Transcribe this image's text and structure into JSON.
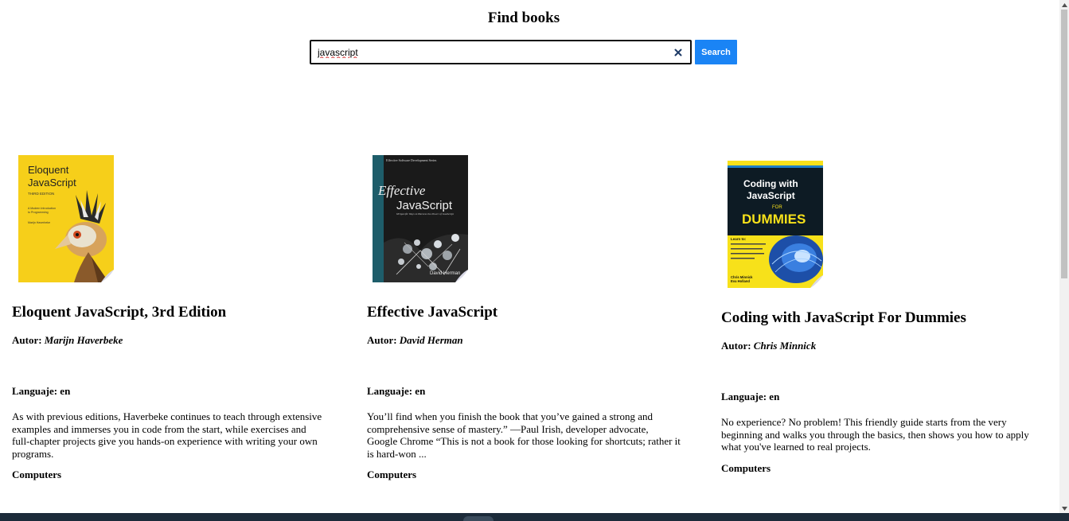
{
  "page": {
    "title": "Find books"
  },
  "search": {
    "value": "javascript",
    "placeholder": "",
    "button_label": "Search",
    "clear_icon": "close-icon"
  },
  "colors": {
    "search_button": "#1a84f5",
    "taskbar": "#1c2b3a"
  },
  "books": [
    {
      "title": "Eloquent JavaScript, 3rd Edition",
      "author_label": "Autor: ",
      "author": "Marijn Haverbeke",
      "language_label": "Languaje: en",
      "description": "As with previous editions, Haverbeke continues to teach through extensive examples and immerses you in code from the start, while exercises and full-chapter projects give you hands-on experience with writing your own programs.",
      "category": "Computers",
      "cover": {
        "title_line1": "Eloquent",
        "title_line2": "JavaScript",
        "edition": "THIRD EDITION",
        "subtitle_line1": "A Modern Introduction",
        "subtitle_line2": "to Programming",
        "author": "Marijn Haverbeke"
      }
    },
    {
      "title": "Effective JavaScript",
      "author_label": "Autor: ",
      "author": "David Herman",
      "language_label": "Languaje: en",
      "description": "You’ll find when you finish the book that you’ve gained a strong and comprehensive sense of mastery.” —Paul Irish, developer advocate, Google Chrome “This is not a book for those looking for shortcuts; rather it is hard-won ...",
      "category": "Computers",
      "cover": {
        "series": "Effective Software Development Series",
        "title_line1": "Effective",
        "title_line2": "JavaScript",
        "subtitle": "68 Specific Ways to Harness the Power of JavaScript",
        "author": "David Herman"
      }
    },
    {
      "title": "Coding with JavaScript For Dummies",
      "author_label": "Autor: ",
      "author": "Chris Minnick",
      "language_label": "Languaje: en",
      "description": "No experience? No problem! This friendly guide starts from the very beginning and walks you through the basics, then shows you how to apply what you've learned to real projects.",
      "category": "Computers",
      "cover": {
        "title_line1": "Coding with",
        "title_line2": "JavaScript",
        "for": "FOR",
        "dummies": "DUMMIES",
        "learn_to": "Learn to:",
        "authors_line1": "Chris Minnick",
        "authors_line2": "Eva Holland"
      }
    }
  ]
}
